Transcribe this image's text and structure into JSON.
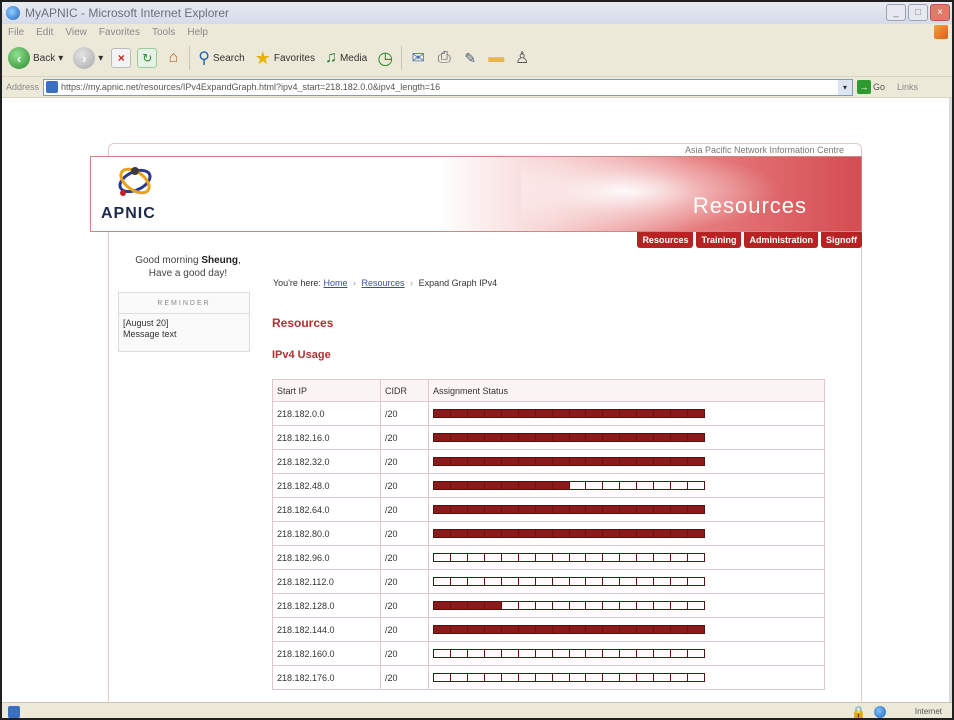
{
  "window": {
    "title": "MyAPNIC - Microsoft Internet Explorer"
  },
  "menu": [
    "File",
    "Edit",
    "View",
    "Favorites",
    "Tools",
    "Help"
  ],
  "toolbar": {
    "back_label": "Back",
    "search_label": "Search",
    "favorites_label": "Favorites",
    "media_label": "Media"
  },
  "address": {
    "label": "Address",
    "url": "https://my.apnic.net/resources/IPv4ExpandGraph.html?ipv4_start=218.182.0.0&ipv4_length=16",
    "go_label": "Go",
    "links_label": "Links"
  },
  "page": {
    "org_name": "Asia Pacific Network Information Centre",
    "logo_text": "APNIC",
    "banner_title": "Resources",
    "nav_tabs": [
      "Resources",
      "Training",
      "Administration",
      "Signoff"
    ],
    "greeting_prefix": "Good morning ",
    "user_name": "Sheung",
    "greeting_suffix": "Have a good day!",
    "reminders_header": "REMINDER",
    "reminder_date": "[August 20]",
    "reminder_text": "Message text",
    "breadcrumb": {
      "prefix": "You're here:",
      "home": "Home",
      "resources": "Resources",
      "current": "Expand Graph IPv4"
    },
    "heading": "Resources",
    "subheading": "IPv4 Usage",
    "table": {
      "headers": [
        "Start IP",
        "CIDR",
        "Assignment Status"
      ],
      "blocks_per_row": 16,
      "rows": [
        {
          "start_ip": "218.182.0.0",
          "cidr": "/20",
          "used_fraction": 1.0
        },
        {
          "start_ip": "218.182.16.0",
          "cidr": "/20",
          "used_fraction": 1.0
        },
        {
          "start_ip": "218.182.32.0",
          "cidr": "/20",
          "used_fraction": 1.0
        },
        {
          "start_ip": "218.182.48.0",
          "cidr": "/20",
          "used_fraction": 0.5
        },
        {
          "start_ip": "218.182.64.0",
          "cidr": "/20",
          "used_fraction": 1.0
        },
        {
          "start_ip": "218.182.80.0",
          "cidr": "/20",
          "used_fraction": 1.0
        },
        {
          "start_ip": "218.182.96.0",
          "cidr": "/20",
          "used_fraction": 0.0
        },
        {
          "start_ip": "218.182.112.0",
          "cidr": "/20",
          "used_fraction": 0.0
        },
        {
          "start_ip": "218.182.128.0",
          "cidr": "/20",
          "used_fraction": 0.25
        },
        {
          "start_ip": "218.182.144.0",
          "cidr": "/20",
          "used_fraction": 1.0
        },
        {
          "start_ip": "218.182.160.0",
          "cidr": "/20",
          "used_fraction": 0.0
        },
        {
          "start_ip": "218.182.176.0",
          "cidr": "/20",
          "used_fraction": 0.0
        }
      ]
    }
  },
  "status": {
    "zone": "Internet"
  },
  "colors": {
    "brand_red": "#b72323",
    "used_block": "#8b1a1a",
    "heading_red": "#b03030"
  }
}
